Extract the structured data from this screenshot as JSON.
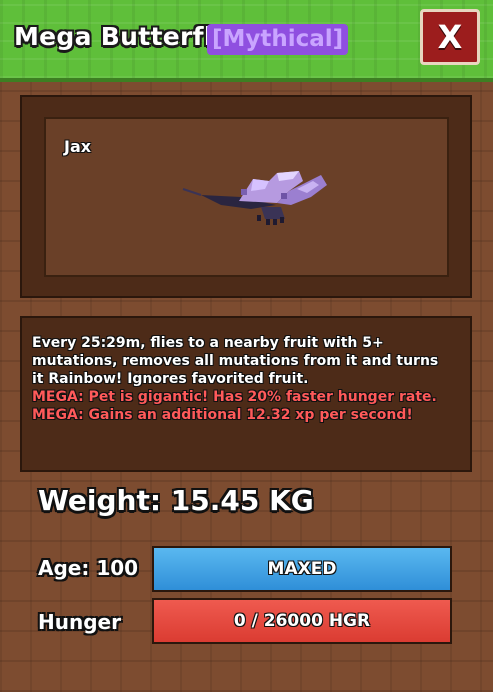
{
  "header": {
    "title": "Mega Butterfly",
    "rarity": "[Mythical]",
    "close_label": "X",
    "rarity_color": "#8f4fe0"
  },
  "preview": {
    "owner_name": "Jax",
    "pet_icon": "mega-butterfly-sprite"
  },
  "description": {
    "lines": [
      "Every 25:29m, flies to a nearby fruit with 5+",
      "mutations, removes all mutations from it and turns",
      "it Rainbow! Ignores favorited fruit."
    ],
    "mega_lines": [
      "MEGA: Pet is gigantic! Has 20% faster hunger rate.",
      "MEGA: Gains an additional 12.32 xp per second!"
    ],
    "mega_color": "#ff5a5a"
  },
  "stats": {
    "weight": "Weight: 15.45 KG",
    "age_label": "Age: 100",
    "age_bar_text": "MAXED",
    "age_progress": 1.0,
    "hunger_label": "Hunger",
    "hunger_bar_text": "0 / 26000 HGR",
    "hunger_progress": 0.0
  }
}
